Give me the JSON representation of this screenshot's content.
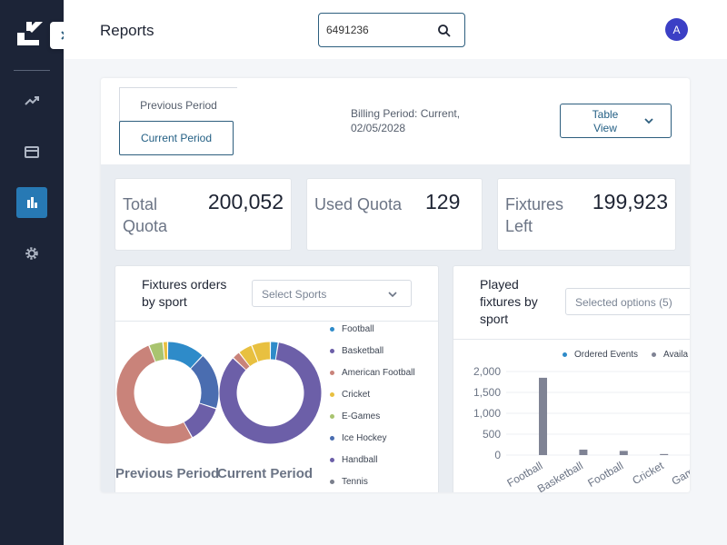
{
  "header": {
    "title": "Reports",
    "avatar_initial": "A"
  },
  "search": {
    "value": "6491236"
  },
  "sidebar": {
    "items": [
      {
        "icon": "trend-icon",
        "active": false
      },
      {
        "icon": "card-icon",
        "active": false
      },
      {
        "icon": "bar-chart-icon",
        "active": true
      },
      {
        "icon": "gear-icon",
        "active": false
      }
    ]
  },
  "period_tabs": {
    "previous": "Previous Period",
    "current": "Current Period",
    "selected": "current"
  },
  "billing": {
    "text": "Billing Period: Current, 02/05/2028"
  },
  "view_toggle": {
    "label": "Table View"
  },
  "stats": [
    {
      "label": "Total Quota",
      "value": "200,052"
    },
    {
      "label": "Used Quota",
      "value": "129"
    },
    {
      "label": "Fixtures Left",
      "value": "199,923"
    }
  ],
  "fixtures_card": {
    "title": "Fixtures orders by sport",
    "select_placeholder": "Select Sports",
    "legend": [
      {
        "name": "Football",
        "color": "#2e8bc9"
      },
      {
        "name": "Basketball",
        "color": "#6c5fa8"
      },
      {
        "name": "American Football",
        "color": "#c9837a"
      },
      {
        "name": "Cricket",
        "color": "#e8c040"
      },
      {
        "name": "E-Games",
        "color": "#a9c46f"
      },
      {
        "name": "Ice Hockey",
        "color": "#4a6db0"
      },
      {
        "name": "Handball",
        "color": "#6c5fa8"
      },
      {
        "name": "Tennis",
        "color": "#7a7f8c"
      }
    ],
    "captions": {
      "previous": "Previous Period",
      "current": "Current Period"
    }
  },
  "played_card": {
    "title": "Played fixtures by sport",
    "select_placeholder": "Selected options (5)",
    "legend": [
      {
        "name": "Ordered Events",
        "color": "#2e8bc9"
      },
      {
        "name": "Availa",
        "color": "#7f8394"
      }
    ]
  },
  "chart_data": [
    {
      "type": "pie",
      "title": "Previous Period",
      "labels": [
        "Football",
        "Ice Hockey",
        "Handball",
        "American Football",
        "E-Games",
        "Cricket"
      ],
      "values": [
        12,
        18,
        12,
        52,
        4.5,
        1.5
      ],
      "colors": [
        "#2e8bc9",
        "#4a6db0",
        "#6c5fa8",
        "#c9837a",
        "#a9c46f",
        "#e8c040"
      ]
    },
    {
      "type": "pie",
      "title": "Current Period",
      "labels": [
        "Football",
        "Basketball",
        "American Football",
        "Cricket",
        "E-Games"
      ],
      "values": [
        2.5,
        84.5,
        2.5,
        4.5,
        6
      ],
      "colors": [
        "#2e8bc9",
        "#6c5fa8",
        "#c9837a",
        "#e8c040",
        "#e8c040"
      ]
    },
    {
      "type": "bar",
      "categories": [
        "Football",
        "Basketball",
        "Football",
        "Cricket",
        "Games"
      ],
      "series": [
        {
          "name": "Ordered Events",
          "values": [
            0,
            0,
            0,
            0,
            0
          ],
          "color": "#2e8bc9"
        },
        {
          "name": "Availa",
          "values": [
            1850,
            130,
            100,
            25,
            15
          ],
          "color": "#7f8394"
        }
      ],
      "yticks": [
        "0",
        "500",
        "1,000",
        "1,500",
        "2,000"
      ],
      "ylim": [
        0,
        2000
      ],
      "grid": true
    }
  ]
}
